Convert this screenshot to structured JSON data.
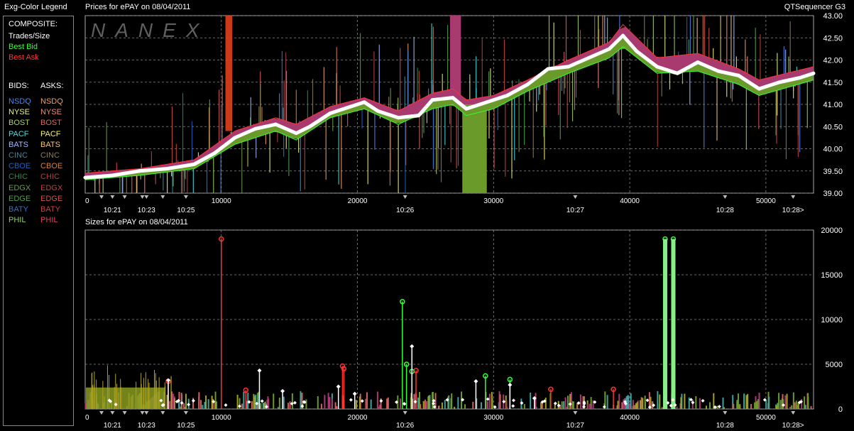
{
  "legend": {
    "title": "Exg-Color Legend",
    "composite_label": "COMPOSITE:",
    "trades_label": "Trades/Size",
    "bid_label": "Best Bid",
    "ask_label": "Best Ask",
    "bids_header": "BIDS:",
    "asks_header": "ASKS:",
    "exchanges": [
      {
        "name": "NSDQ",
        "bid_color": "#4a86e8",
        "ask_color": "#f0a060"
      },
      {
        "name": "NYSE",
        "bid_color": "#e8f08a",
        "ask_color": "#f08a7a"
      },
      {
        "name": "BOST",
        "bid_color": "#a8d070",
        "ask_color": "#e06060"
      },
      {
        "name": "PACF",
        "bid_color": "#40e0e0",
        "ask_color": "#f8f070"
      },
      {
        "name": "BATS",
        "bid_color": "#a0b8ff",
        "ask_color": "#f0c878"
      },
      {
        "name": "CINC",
        "bid_color": "#3a8aa0",
        "ask_color": "#8a7a60"
      },
      {
        "name": "CBOE",
        "bid_color": "#2060c0",
        "ask_color": "#d08040"
      },
      {
        "name": "CHIC",
        "bid_color": "#2a8a50",
        "ask_color": "#b04040"
      },
      {
        "name": "EDGX",
        "bid_color": "#6a9a50",
        "ask_color": "#c04040"
      },
      {
        "name": "EDGE",
        "bid_color": "#50a050",
        "ask_color": "#d05050"
      },
      {
        "name": "BATY",
        "bid_color": "#3a70d0",
        "ask_color": "#d04040"
      },
      {
        "name": "PHIL",
        "bid_color": "#90d060",
        "ask_color": "#e04060"
      }
    ]
  },
  "colors": {
    "trades": "#ffffff",
    "best_bid": "#33ff33",
    "best_ask": "#ff3333",
    "bid_band": "#6a9a2a",
    "ask_band": "#a83a70",
    "nanex_watermark": "#6a6a6a"
  },
  "app_title": "QTSequencer G3",
  "watermark": "NANEX",
  "chart_data": [
    {
      "type": "line",
      "title": "Prices for  ePAY  on  08/04/2011",
      "x_ticks": [
        0,
        10000,
        20000,
        30000,
        40000,
        50000
      ],
      "x_ticks_labels": [
        "0",
        "10000",
        "20000",
        "30000",
        "40000",
        "50000"
      ],
      "time_labels": [
        "10:21",
        "10:23",
        "10:25",
        "10:26",
        "10:27",
        "10:28",
        "10:28>"
      ],
      "time_label_x": [
        2000,
        4500,
        7400,
        23500,
        36000,
        47000,
        52000
      ],
      "xlim": [
        0,
        53500
      ],
      "y_ticks": [
        39.0,
        39.5,
        40.0,
        40.5,
        41.0,
        41.5,
        42.0,
        42.5,
        43.0
      ],
      "y_ticks_labels": [
        "39.00",
        "39.50",
        "40.00",
        "40.50",
        "41.00",
        "41.50",
        "42.00",
        "42.50",
        "43.00"
      ],
      "ylim": [
        39.0,
        43.0
      ],
      "grid": true,
      "series": [
        {
          "name": "Trades/Size",
          "x": [
            0,
            2000,
            4000,
            6000,
            8000,
            9500,
            11000,
            12500,
            14000,
            15500,
            16500,
            18000,
            19500,
            20500,
            21500,
            23000,
            24500,
            25500,
            27000,
            28000,
            29500,
            31000,
            32500,
            34000,
            35500,
            37000,
            38500,
            39500,
            40500,
            42000,
            43500,
            45000,
            46500,
            48000,
            49500,
            51000,
            52500,
            53500
          ],
          "y": [
            39.35,
            39.4,
            39.5,
            39.55,
            39.65,
            39.9,
            40.25,
            40.45,
            40.55,
            40.35,
            40.5,
            40.8,
            40.95,
            41.05,
            40.85,
            40.7,
            40.75,
            41.1,
            41.15,
            40.9,
            41.05,
            41.2,
            41.45,
            41.8,
            41.85,
            42.05,
            42.25,
            42.55,
            42.2,
            41.85,
            41.7,
            41.95,
            41.75,
            41.65,
            41.35,
            41.5,
            41.6,
            41.7
          ]
        },
        {
          "name": "Best Bid",
          "x": [
            0,
            4000,
            8000,
            11000,
            14000,
            15500,
            18000,
            20500,
            23000,
            25500,
            27000,
            28000,
            30000,
            32500,
            35500,
            38500,
            39500,
            42000,
            45000,
            48000,
            49500,
            53500
          ],
          "y": [
            39.3,
            39.4,
            39.55,
            40.1,
            40.4,
            40.2,
            40.7,
            40.9,
            40.55,
            40.9,
            41.0,
            40.75,
            40.9,
            41.3,
            41.7,
            42.05,
            42.3,
            41.7,
            41.75,
            41.45,
            41.2,
            41.55
          ]
        },
        {
          "name": "Best Ask",
          "x": [
            0,
            4000,
            8000,
            11000,
            14000,
            15500,
            18000,
            20500,
            23000,
            25500,
            27000,
            28000,
            30000,
            32500,
            35500,
            38500,
            39500,
            42000,
            45000,
            48000,
            49500,
            53500
          ],
          "y": [
            39.45,
            39.55,
            39.75,
            40.4,
            40.7,
            40.55,
            40.95,
            41.15,
            40.85,
            41.25,
            41.35,
            41.1,
            41.2,
            41.55,
            42.0,
            42.4,
            42.8,
            42.05,
            42.15,
            41.8,
            41.55,
            41.85
          ]
        }
      ]
    },
    {
      "type": "bar",
      "title": "Sizes for  ePAY  on  08/04/2011",
      "x_ticks": [
        0,
        10000,
        20000,
        30000,
        40000,
        50000
      ],
      "x_ticks_labels": [
        "0",
        "10000",
        "20000",
        "30000",
        "40000",
        "50000"
      ],
      "time_labels": [
        "10:21",
        "10:23",
        "10:25",
        "10:26",
        "10:27",
        "10:28",
        "10:28>"
      ],
      "time_label_x": [
        2000,
        4500,
        7400,
        23500,
        36000,
        47000,
        52000
      ],
      "xlim": [
        0,
        53500
      ],
      "y_ticks": [
        0,
        5000,
        10000,
        15000,
        20000
      ],
      "y_ticks_labels": [
        "0",
        "5000",
        "10000",
        "15000",
        "20000"
      ],
      "ylim": [
        0,
        20000
      ],
      "grid": true,
      "series": [
        {
          "name": "Best Bid",
          "x": [
            23300,
            23600,
            24000,
            29400,
            31200,
            42600,
            43200
          ],
          "values": [
            12000,
            5000,
            4200,
            3700,
            3300,
            19000,
            19000
          ]
        },
        {
          "name": "Best Ask",
          "x": [
            6100,
            10000,
            11800,
            18900,
            19000,
            24300,
            34200,
            38800
          ],
          "values": [
            3100,
            19000,
            2100,
            4800,
            4500,
            4300,
            2200,
            2200
          ]
        },
        {
          "name": "Trades/Size",
          "x": [
            6100,
            12800,
            14500,
            18600,
            19800,
            24000,
            28700,
            31200,
            33000
          ],
          "values": [
            3200,
            4300,
            2000,
            2500,
            1700,
            7000,
            3100,
            2700,
            1200
          ]
        }
      ]
    }
  ]
}
